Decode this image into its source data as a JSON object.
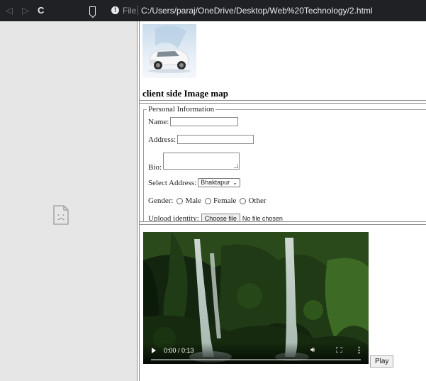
{
  "toolbar": {
    "file_label": "File",
    "url": "C:/Users/paraj/OneDrive/Desktop/Web%20Technology/2.html",
    "icons": {
      "back": "arrow-left-icon",
      "forward": "arrow-right-icon",
      "reload": "reload-icon",
      "bookmark": "bookmark-icon",
      "info": "info-icon"
    }
  },
  "left_frame": {
    "icon": "sad-page-icon"
  },
  "image_map": {
    "heading": "client side Image map"
  },
  "form": {
    "legend": "Personal Information",
    "name_label": "Name:",
    "name_value": "",
    "address_label": "Address:",
    "address_value": "",
    "bio_label": "Bio:",
    "bio_value": "",
    "select_label": "Select Address:",
    "select_value": "Bhaktapur",
    "gender_label": "Gender:",
    "gender_options": [
      "Male",
      "Female",
      "Other"
    ],
    "upload_label": "Upload identity:",
    "upload_button": "Choose file",
    "upload_status": "No file chosen"
  },
  "video": {
    "time": "0:00 / 0:13",
    "progress": 0,
    "play_button": "Play"
  },
  "colors": {
    "toolbar_bg": "#202124",
    "left_frame_bg": "#e6e6e6"
  }
}
